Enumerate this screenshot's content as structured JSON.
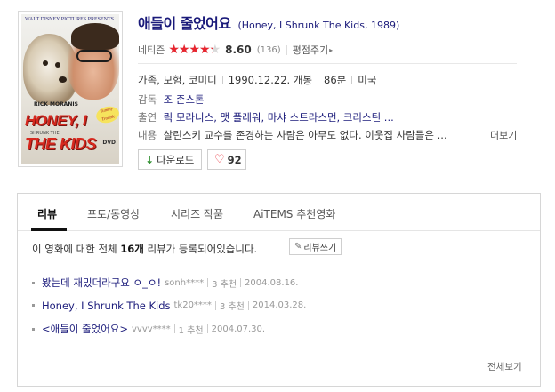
{
  "movie": {
    "title": "애들이 줄었어요",
    "original_title": "(Honey, I Shrunk The Kids, 1989)",
    "poster": {
      "studio": "WALT DISNEY PICTURES PRESENTS",
      "actor": "RICK MORANIS",
      "title_line1": "HONEY, I",
      "subtitle": "SHRUNK THE",
      "title_line2": "THE KIDS",
      "badge": "Tummy Trouble",
      "disc": "DVD"
    },
    "rating": {
      "label": "네티즌",
      "score": "8.60",
      "score_fraction": 0.86,
      "count": "(136)",
      "rate_link": "평점주기",
      "star_color": "#e7252f"
    },
    "info": {
      "genre": "가족, 모험, 코미디",
      "release": "1990.12.22. 개봉",
      "runtime": "86분",
      "country": "미국",
      "director_label": "감독",
      "director": "조 존스톤",
      "cast_label": "출연",
      "cast": "릭 모라니스, 맷 플레워, 마샤 스트라스먼, 크리스틴 ...",
      "plot_label": "내용",
      "plot": "살린스키 교수를 존경하는 사람은 아무도 없다. 이웃집 사람들은 ...",
      "more": "더보기"
    },
    "buttons": {
      "download": "다운로드",
      "like_count": "92"
    }
  },
  "reviews": {
    "tabs": [
      {
        "label": "리뷰"
      },
      {
        "label": "포토/동영상"
      },
      {
        "label": "시리즈 작품"
      },
      {
        "label": "AiTEMS 추천영화"
      }
    ],
    "summary_prefix": "이 영화에 대한 전체",
    "summary_count": "16개",
    "summary_suffix": "리뷰가 등록되어있습니다.",
    "write_button": "리뷰쓰기",
    "items": [
      {
        "title": "봤는데 재밌더라구요 ㅇ_ㅇ!",
        "user": "sonh****",
        "votes": "3 추천",
        "date": "2004.08.16."
      },
      {
        "title": "Honey, I Shrunk The Kids",
        "user": "tk20****",
        "votes": "3 추천",
        "date": "2014.03.28."
      },
      {
        "title": "<애들이 줄었어요>",
        "user": "vvvv****",
        "votes": "1 추천",
        "date": "2004.07.30."
      }
    ],
    "view_all": "전체보기"
  }
}
